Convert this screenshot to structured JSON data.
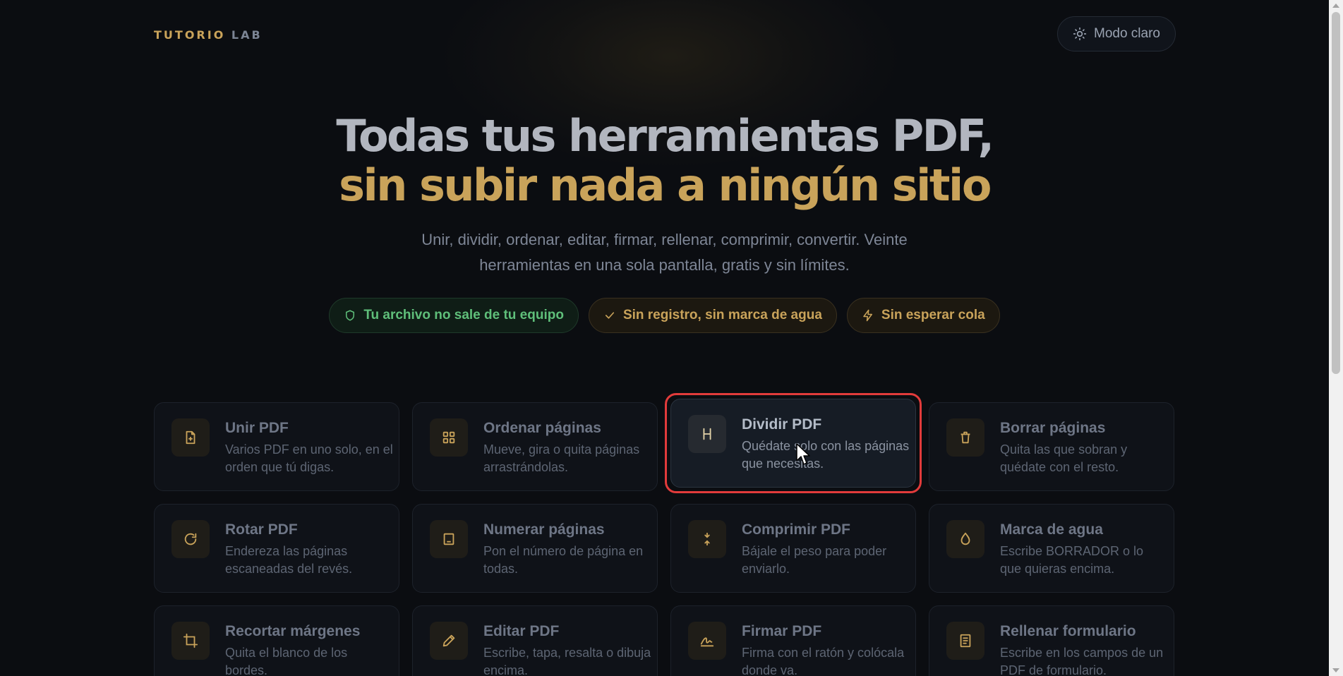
{
  "brand": {
    "part1": "TUTORIO",
    "part2": "LAB"
  },
  "theme_toggle": {
    "label": "Modo claro",
    "icon": "sun-icon"
  },
  "hero": {
    "title_line1": "Todas tus herramientas PDF,",
    "title_line2": "sin subir nada a ningún sitio",
    "subtitle": "Unir, dividir, ordenar, editar, firmar, rellenar, comprimir, convertir. Veinte herramientas en una sola pantalla, gratis y sin límites."
  },
  "badges": [
    {
      "label": "Tu archivo no sale de tu equipo",
      "icon": "shield-icon",
      "color": "#5fbf7a"
    },
    {
      "label": "Sin registro, sin marca de agua",
      "icon": "check-icon",
      "color": "#c9a35a"
    },
    {
      "label": "Sin esperar cola",
      "icon": "bolt-icon",
      "color": "#c9a35a"
    }
  ],
  "tools": [
    {
      "title": "Unir PDF",
      "desc": "Varios PDF en uno solo, en el orden que tú digas.",
      "icon": "file-plus-icon"
    },
    {
      "title": "Ordenar páginas",
      "desc": "Mueve, gira o quita páginas arrastrándolas.",
      "icon": "grid-icon"
    },
    {
      "title": "Dividir PDF",
      "desc": "Quédate solo con las páginas que necesitas.",
      "icon": "split-icon"
    },
    {
      "title": "Borrar páginas",
      "desc": "Quita las que sobran y quédate con el resto.",
      "icon": "trash-icon"
    },
    {
      "title": "Rotar PDF",
      "desc": "Endereza las páginas escaneadas del revés.",
      "icon": "rotate-icon"
    },
    {
      "title": "Numerar páginas",
      "desc": "Pon el número de página en todas.",
      "icon": "page-number-icon"
    },
    {
      "title": "Comprimir PDF",
      "desc": "Bájale el peso para poder enviarlo.",
      "icon": "compress-icon"
    },
    {
      "title": "Marca de agua",
      "desc": "Escribe BORRADOR o lo que quieras encima.",
      "icon": "droplet-icon"
    },
    {
      "title": "Recortar márgenes",
      "desc": "Quita el blanco de los bordes.",
      "icon": "crop-icon"
    },
    {
      "title": "Editar PDF",
      "desc": "Escribe, tapa, resalta o dibuja encima.",
      "icon": "pencil-icon"
    },
    {
      "title": "Firmar PDF",
      "desc": "Firma con el ratón y colócala donde va.",
      "icon": "signature-icon"
    },
    {
      "title": "Rellenar formulario",
      "desc": "Escribe en los campos de un PDF de formulario.",
      "icon": "form-icon"
    }
  ],
  "colors": {
    "accent": "#c9a35a",
    "background": "#0b0d11",
    "highlight": "#e23b3b",
    "success": "#5fbf7a"
  }
}
